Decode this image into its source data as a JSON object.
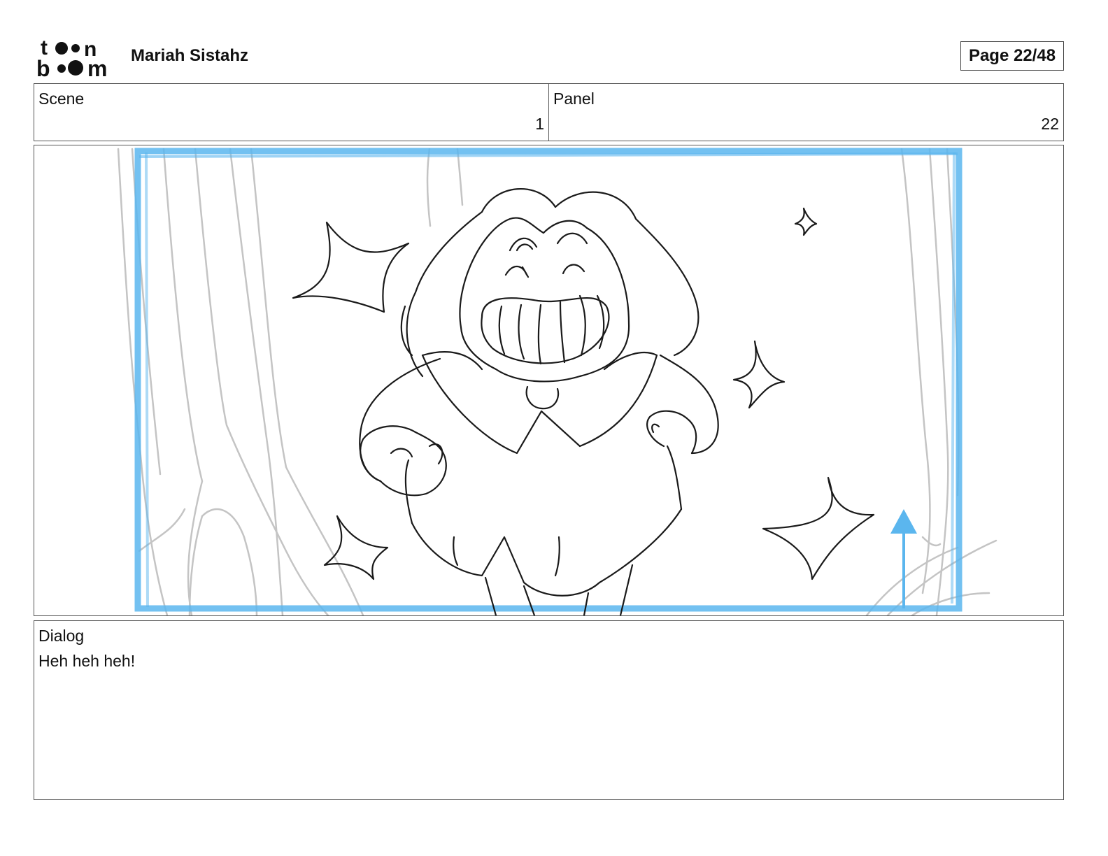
{
  "header": {
    "logo_text": "toon boom",
    "project_title": "Mariah Sistahz",
    "page_indicator": "Page 22/48"
  },
  "info": {
    "scene_label": "Scene",
    "scene_value": "1",
    "panel_label": "Panel",
    "panel_value": "22"
  },
  "dialog": {
    "label": "Dialog",
    "text": "Heh heh heh!"
  },
  "colors": {
    "camera_frame": "#5bb6ee",
    "sketch_line": "#1a1a1a",
    "background_sketch": "#c4c4c4"
  }
}
